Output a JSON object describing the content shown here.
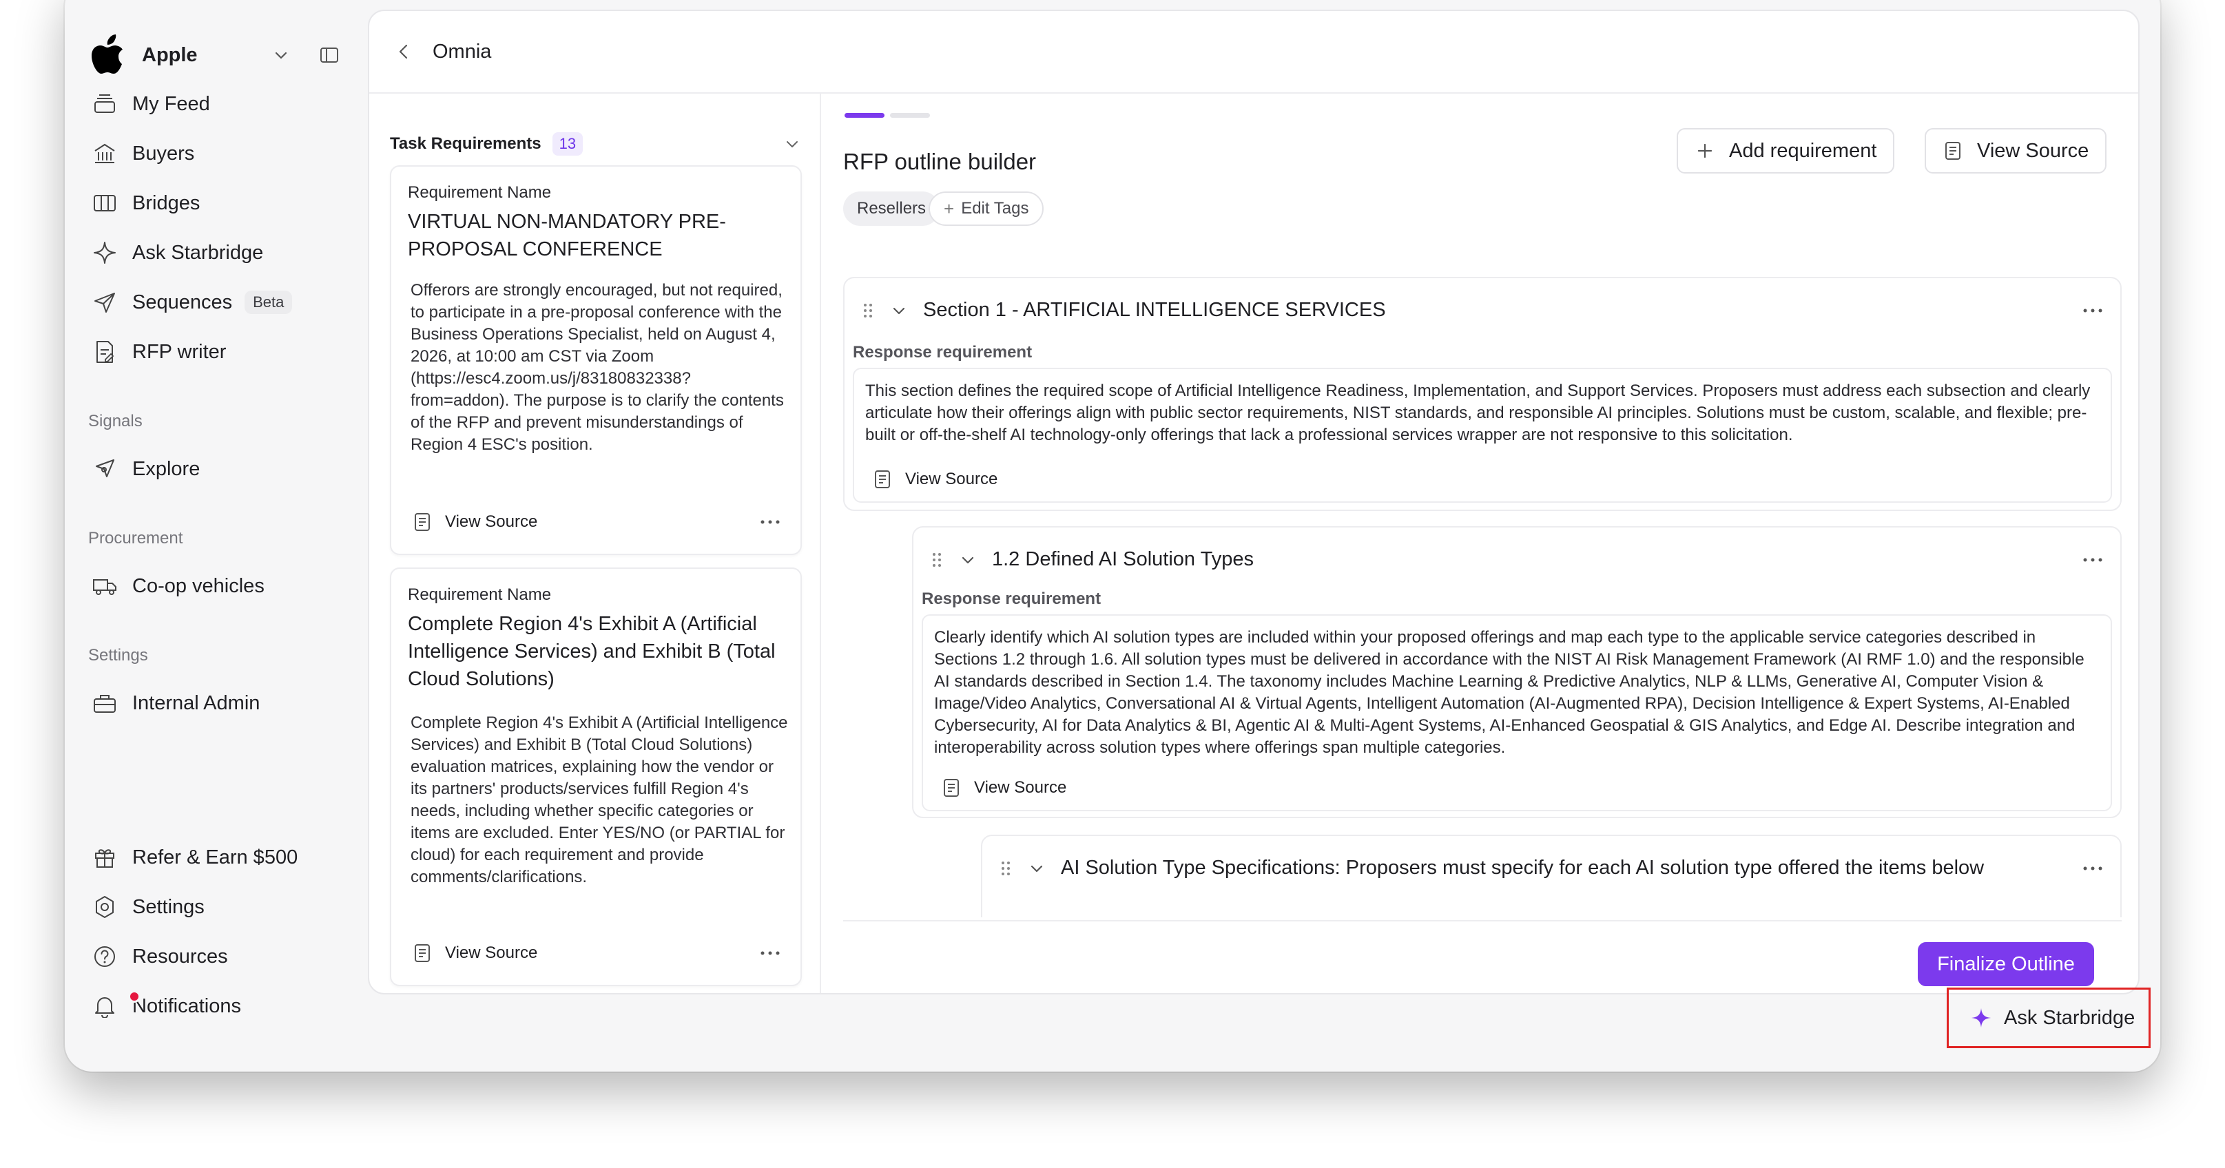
{
  "org": {
    "name": "Apple"
  },
  "nav": {
    "my_feed": "My Feed",
    "buyers": "Buyers",
    "bridges": "Bridges",
    "ask_starbridge": "Ask Starbridge",
    "sequences": "Sequences",
    "sequences_badge": "Beta",
    "rfp_writer": "RFP writer",
    "signals_section": "Signals",
    "explore": "Explore",
    "procurement_section": "Procurement",
    "coop_vehicles": "Co-op vehicles",
    "settings_section": "Settings",
    "internal_admin": "Internal Admin",
    "refer_earn": "Refer & Earn $500",
    "settings": "Settings",
    "resources": "Resources",
    "notifications": "Notifications"
  },
  "header": {
    "title": "Omnia"
  },
  "task_requirements": {
    "title": "Task Requirements",
    "count": "13",
    "cards": [
      {
        "label": "Requirement Name",
        "name": "VIRTUAL NON-MANDATORY PRE-PROPOSAL CONFERENCE",
        "description": "Offerors are strongly encouraged, but not required, to participate in a pre-proposal conference with the Business Operations Specialist, held on August 4, 2026, at 10:00 am CST via Zoom (https://esc4.zoom.us/j/83180832338?from=addon). The purpose is to clarify the contents of the RFP and prevent misunderstandings of Region 4 ESC's position.",
        "view_source": "View Source"
      },
      {
        "label": "Requirement Name",
        "name": "Complete Region 4's Exhibit A (Artificial Intelligence Services) and Exhibit B (Total Cloud Solutions)",
        "description": "Complete Region 4's Exhibit A (Artificial Intelligence Services) and Exhibit B (Total Cloud Solutions) evaluation matrices, explaining how the vendor or its partners' products/services fulfill Region 4's needs, including whether specific categories or items are excluded. Enter YES/NO (or PARTIAL for cloud) for each requirement and provide comments/clarifications.",
        "view_source": "View Source"
      }
    ]
  },
  "builder": {
    "title": "RFP outline builder",
    "tags": [
      "Resellers"
    ],
    "edit_tags": "Edit Tags",
    "add_requirement": "Add requirement",
    "view_source": "View Source",
    "finalize": "Finalize Outline",
    "sections": [
      {
        "title": "Section 1 - ARTIFICIAL INTELLIGENCE SERVICES",
        "response_label": "Response requirement",
        "response_text": "This section defines the required scope of Artificial Intelligence Readiness, Implementation, and Support Services. Proposers must address each subsection and clearly articulate how their offerings align with public sector requirements, NIST standards, and responsible AI principles. Solutions must be custom, scalable, and flexible; pre-built or off-the-shelf AI technology-only offerings that lack a professional services wrapper are not responsive to this solicitation.",
        "view_source": "View Source"
      },
      {
        "title": "1.2 Defined AI Solution Types",
        "response_label": "Response requirement",
        "response_text": "Clearly identify which AI solution types are included within your proposed offerings and map each type to the applicable service categories described in Sections 1.2 through 1.6. All solution types must be delivered in accordance with the NIST AI Risk Management Framework (AI RMF 1.0) and the responsible AI standards described in Section 1.4. The taxonomy includes Machine Learning & Predictive Analytics, NLP & LLMs, Generative AI, Computer Vision & Image/Video Analytics, Conversational AI & Virtual Agents, Intelligent Automation (AI-Augmented RPA), Decision Intelligence & Expert Systems, AI-Enabled Cybersecurity, AI for Data Analytics & BI, Agentic AI & Multi-Agent Systems, AI-Enhanced Geospatial & GIS Analytics, and Edge AI. Describe integration and interoperability across solution types where offerings span multiple categories.",
        "view_source": "View Source"
      },
      {
        "title": "AI Solution Type Specifications: Proposers must specify for each AI solution type offered the items below"
      }
    ],
    "progress": 0.5
  },
  "ask_starbridge": {
    "label": "Ask Starbridge"
  },
  "colors": {
    "accent": "#7c3aed",
    "highlight_border": "#e02424",
    "notification": "#e5173f"
  }
}
